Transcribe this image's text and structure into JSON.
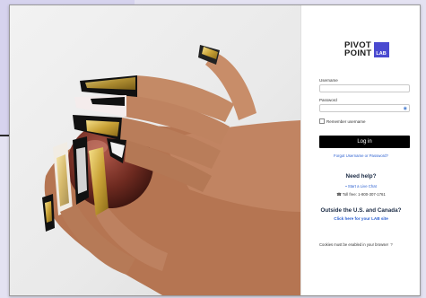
{
  "colors": {
    "accent": "#2a5fd0",
    "brand": "#4a4ad0",
    "button": "#000000"
  },
  "logo": {
    "line1": "PIVOT",
    "line2": "POINT",
    "box": "LAB"
  },
  "form": {
    "username_label": "Username",
    "password_label": "Password",
    "remember_label": "Remember username",
    "login_label": "Log in",
    "forgot_label": "Forgot Username or Password?"
  },
  "help": {
    "heading": "Need help?",
    "chat_label": "Start a Live Chat",
    "toll_label": "Toll free: 1-800-307-1761"
  },
  "outside": {
    "heading": "Outside the U.S. and Canada?",
    "link_label": "Click here for your LAB site"
  },
  "cookies": {
    "text": "Cookies must be enabled in your browser"
  },
  "icons": {
    "eye": "eye-icon",
    "chat": "chat-icon",
    "phone": "phone-icon",
    "help": "question-circle-icon"
  }
}
